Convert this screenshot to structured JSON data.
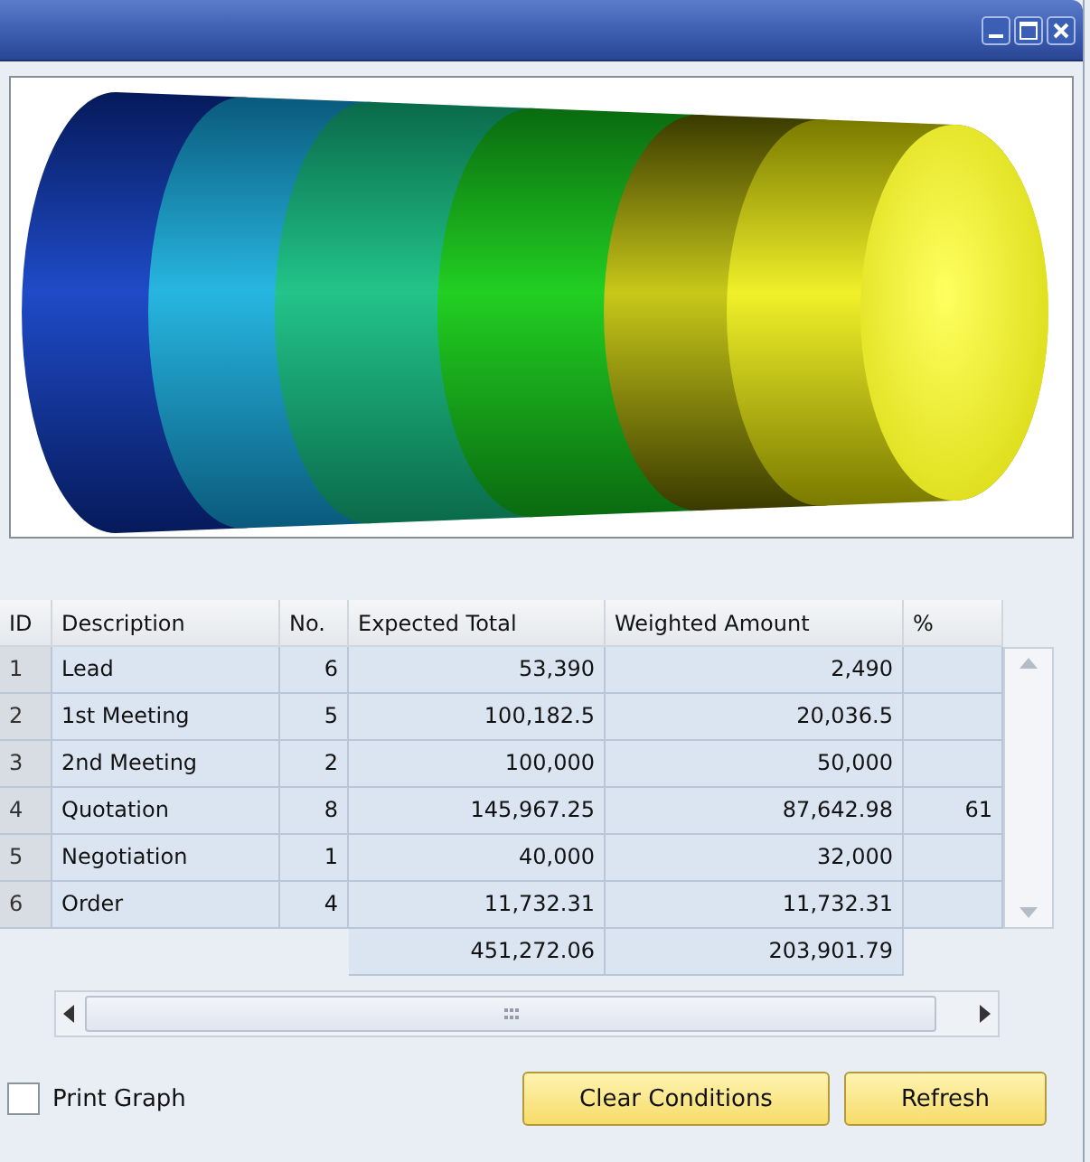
{
  "table": {
    "columns": [
      "ID",
      "Description",
      "No.",
      "Expected Total",
      "Weighted Amount",
      "%"
    ],
    "rows": [
      {
        "id": "1",
        "description": "Lead",
        "count": "6",
        "expected_total": "53,390",
        "weighted_amount": "2,490"
      },
      {
        "id": "2",
        "description": "1st Meeting",
        "count": "5",
        "expected_total": "100,182.5",
        "weighted_amount": "20,036.5"
      },
      {
        "id": "3",
        "description": "2nd Meeting",
        "count": "2",
        "expected_total": "100,000",
        "weighted_amount": "50,000"
      },
      {
        "id": "4",
        "description": "Quotation",
        "count": "8",
        "expected_total": "145,967.25",
        "weighted_amount": "87,642.98",
        "percent": "61"
      },
      {
        "id": "5",
        "description": "Negotiation",
        "count": "1",
        "expected_total": "40,000",
        "weighted_amount": "32,000"
      },
      {
        "id": "6",
        "description": "Order",
        "count": "4",
        "expected_total": "11,732.31",
        "weighted_amount": "11,732.31"
      }
    ],
    "totals": {
      "expected_total": "451,272.06",
      "weighted_amount": "203,901.79"
    }
  },
  "print_graph": {
    "label": "Print Graph",
    "checked": false
  },
  "buttons": [
    {
      "label": "Clear Conditions"
    },
    {
      "label": "Refresh"
    }
  ]
}
